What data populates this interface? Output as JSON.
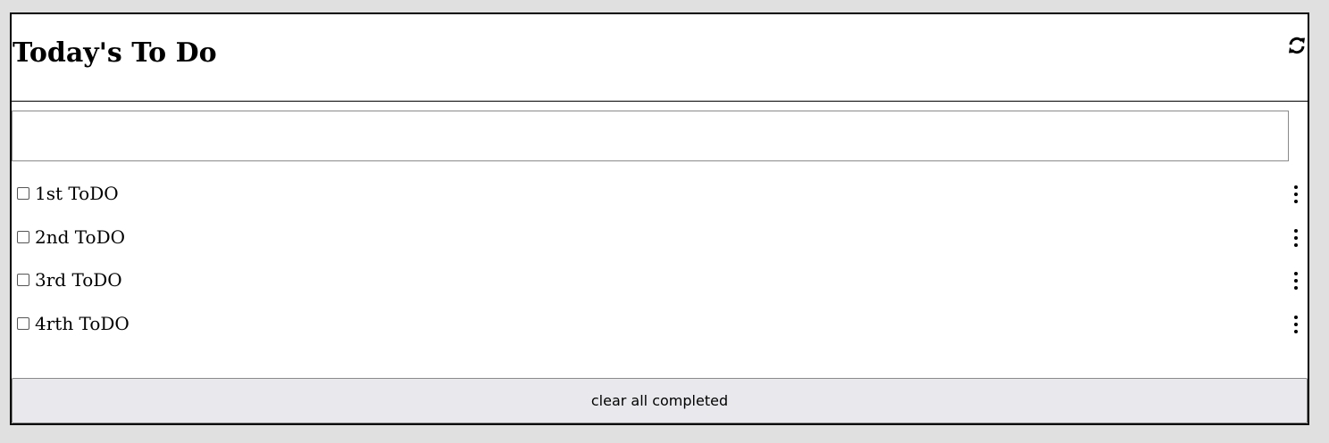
{
  "header": {
    "title": "Today's To Do",
    "refresh_icon": "refresh-icon"
  },
  "new_todo": {
    "value": "",
    "placeholder": ""
  },
  "todos": [
    {
      "label": "1st ToDO",
      "completed": false,
      "menu_icon": "kebab-menu-icon"
    },
    {
      "label": "2nd ToDO",
      "completed": false,
      "menu_icon": "kebab-menu-icon"
    },
    {
      "label": "3rd ToDO",
      "completed": false,
      "menu_icon": "kebab-menu-icon"
    },
    {
      "label": "4rth ToDO",
      "completed": false,
      "menu_icon": "kebab-menu-icon"
    }
  ],
  "footer": {
    "clear_label": "clear all completed"
  },
  "colors": {
    "page_background": "#e0e0e0",
    "panel_background": "#ffffff",
    "border": "#000000",
    "button_background": "#e9e9ed"
  }
}
